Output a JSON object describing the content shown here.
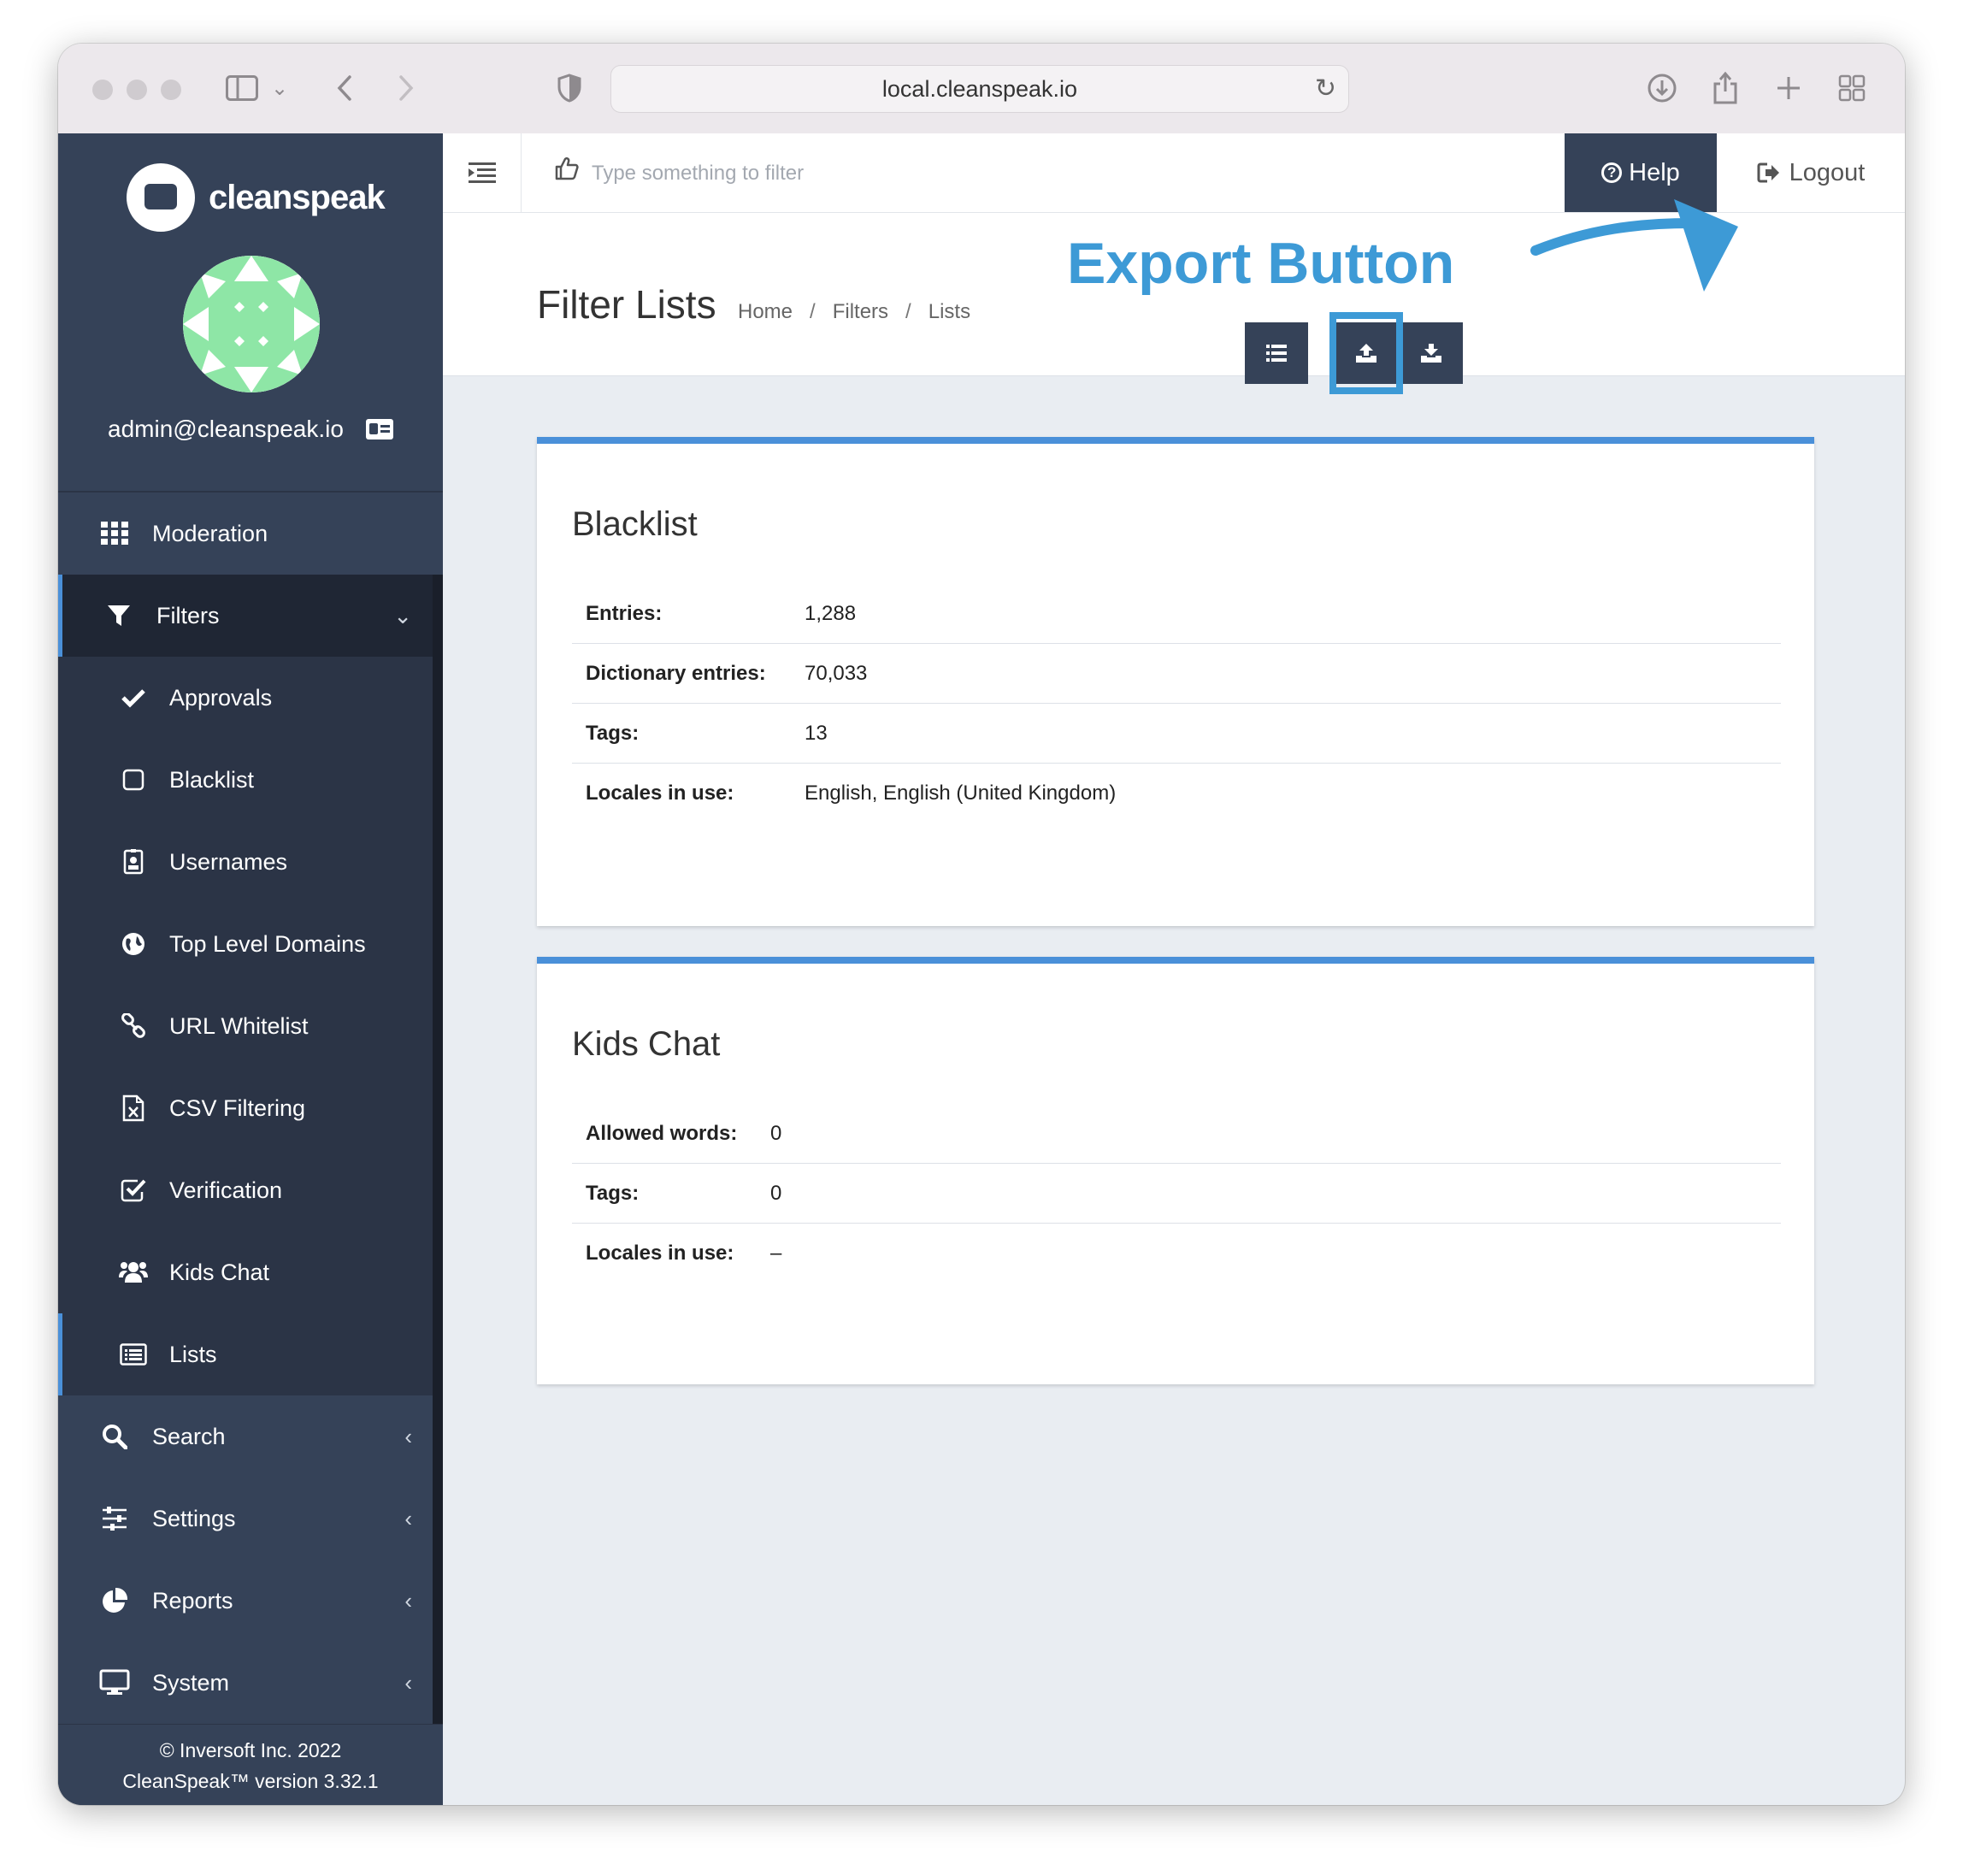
{
  "browser": {
    "url": "local.cleanspeak.io"
  },
  "sidebar": {
    "brand": "cleanspeak",
    "user_email": "admin@cleanspeak.io",
    "items": [
      {
        "label": "Moderation",
        "icon": "grid-icon"
      },
      {
        "label": "Filters",
        "icon": "filter-icon",
        "expanded": true
      },
      {
        "label": "Approvals",
        "icon": "check-icon"
      },
      {
        "label": "Blacklist",
        "icon": "square-icon"
      },
      {
        "label": "Usernames",
        "icon": "user-badge-icon"
      },
      {
        "label": "Top Level Domains",
        "icon": "globe-icon"
      },
      {
        "label": "URL Whitelist",
        "icon": "link-icon"
      },
      {
        "label": "CSV Filtering",
        "icon": "excel-file-icon"
      },
      {
        "label": "Verification",
        "icon": "checkbox-icon"
      },
      {
        "label": "Kids Chat",
        "icon": "users-icon"
      },
      {
        "label": "Lists",
        "icon": "list-icon",
        "active": true
      },
      {
        "label": "Search",
        "icon": "search-icon"
      },
      {
        "label": "Settings",
        "icon": "sliders-icon"
      },
      {
        "label": "Reports",
        "icon": "pie-chart-icon"
      },
      {
        "label": "System",
        "icon": "monitor-icon"
      }
    ],
    "footer_line1": "© Inversoft Inc. 2022",
    "footer_line2": "CleanSpeak™ version 3.32.1"
  },
  "topbar": {
    "filter_placeholder": "Type something to filter",
    "help_label": "Help",
    "logout_label": "Logout"
  },
  "page": {
    "title": "Filter Lists",
    "breadcrumb": [
      "Home",
      "Filters",
      "Lists"
    ],
    "annotation": "Export Button"
  },
  "panels": [
    {
      "title": "Blacklist",
      "rows": [
        {
          "key": "Entries:",
          "value": "1,288"
        },
        {
          "key": "Dictionary entries:",
          "value": "70,033"
        },
        {
          "key": "Tags:",
          "value": "13"
        },
        {
          "key": "Locales in use:",
          "value": "English, English (United Kingdom)"
        }
      ]
    },
    {
      "title": "Kids Chat",
      "rows": [
        {
          "key": "Allowed words:",
          "value": "0"
        },
        {
          "key": "Tags:",
          "value": "0"
        },
        {
          "key": "Locales in use:",
          "value": "–"
        }
      ]
    }
  ],
  "colors": {
    "sidebar_bg": "#2b3446",
    "sidebar_header": "#354258",
    "accent": "#4a90d9",
    "annotation": "#3d9ad6"
  }
}
